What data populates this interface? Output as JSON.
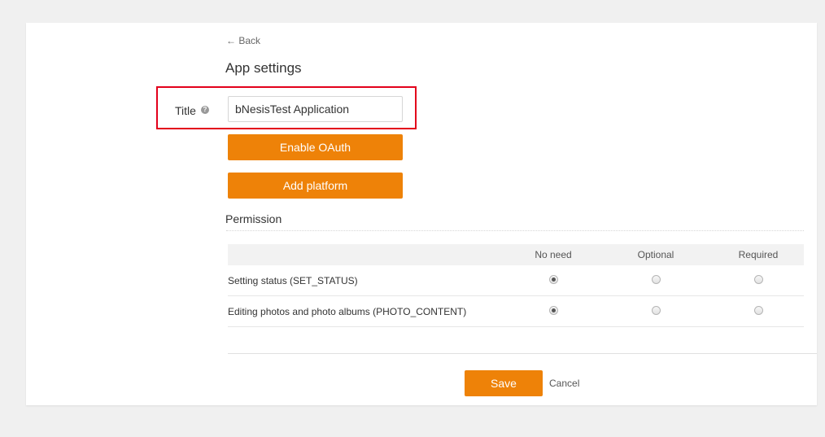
{
  "nav": {
    "back_label": "← Back"
  },
  "page": {
    "title": "App settings"
  },
  "form": {
    "title_label": "Title",
    "title_value": "bNesisTest Application",
    "help_glyph": "?"
  },
  "buttons": {
    "enable_oauth": "Enable OAuth",
    "add_platform": "Add platform",
    "save": "Save",
    "cancel": "Cancel"
  },
  "permissions": {
    "heading": "Permission",
    "columns": [
      "No need",
      "Optional",
      "Required"
    ],
    "rows": [
      {
        "label": "Setting status (SET_STATUS)",
        "selected": "No need"
      },
      {
        "label": "Editing photos and photo albums (PHOTO_CONTENT)",
        "selected": "No need"
      }
    ]
  },
  "colors": {
    "accent": "#ee8208",
    "highlight": "#e3001b"
  }
}
